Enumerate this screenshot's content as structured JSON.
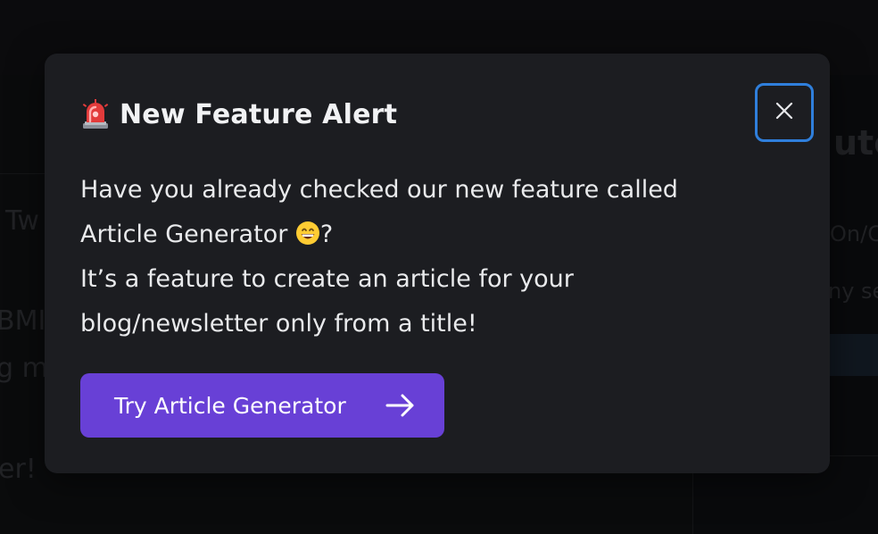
{
  "background": {
    "left_fragments": [
      "Tw",
      "BMI",
      "g m",
      "er!"
    ],
    "right_fragments": [
      "ute",
      "On/C",
      "ny se"
    ]
  },
  "modal": {
    "title": "New Feature Alert",
    "title_icon": "siren-icon",
    "body_line1_a": "Have you already checked our new feature called",
    "body_line1_b": "Article Generator",
    "body_line1_emoji": "grinning-face-icon",
    "body_line1_end": "?",
    "body_line2": "It’s a feature to create an article for your blog/newsletter only from a title!",
    "cta_label": "Try Article Generator",
    "cta_icon": "arrow-right-icon",
    "close_icon": "close-icon"
  },
  "colors": {
    "accent": "#6840d6",
    "focus_ring": "#2f7fdc",
    "modal_bg": "#1c1d21"
  }
}
